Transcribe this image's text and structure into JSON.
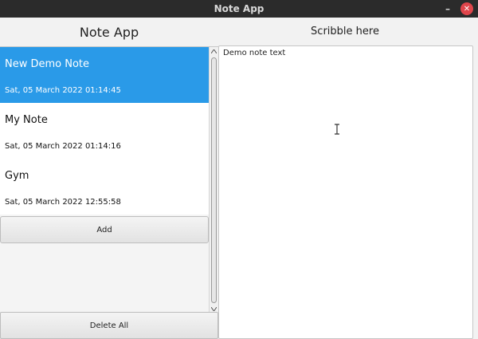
{
  "window": {
    "title": "Note App",
    "minimize_glyph": "–",
    "close_glyph": "✕"
  },
  "left": {
    "heading": "Note App",
    "notes": [
      {
        "title": "New Demo Note",
        "date": "Sat, 05 March 2022 01:14:45",
        "selected": true
      },
      {
        "title": "My Note",
        "date": "Sat, 05 March 2022 01:14:16",
        "selected": false
      },
      {
        "title": "Gym",
        "date": "Sat, 05 March 2022 12:55:58",
        "selected": false
      }
    ],
    "add_label": "Add",
    "delete_all_label": "Delete All"
  },
  "right": {
    "heading": "Scribble here",
    "note_text": "Demo note text"
  },
  "icons": {
    "scroll_up": "scroll-up-icon",
    "scroll_down": "scroll-down-icon",
    "cursor": "text-cursor-icon"
  },
  "colors": {
    "selection": "#2a9ae8",
    "titlebar": "#2b2b2b",
    "close": "#e0454b"
  }
}
